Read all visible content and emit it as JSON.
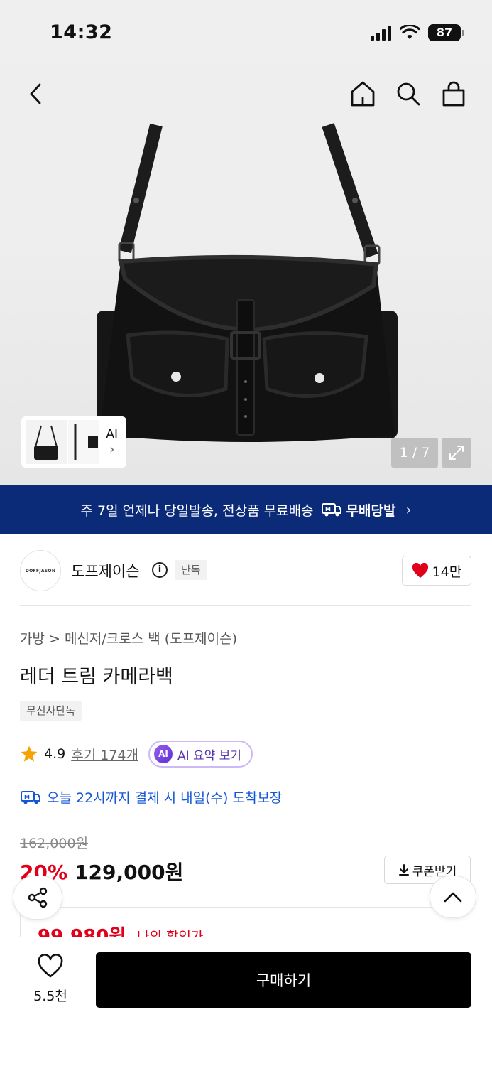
{
  "status_bar": {
    "time": "14:32",
    "battery": "87"
  },
  "gallery": {
    "thumb_label": "AI",
    "thumb_chevron": "›",
    "pager": "1 / 7",
    "icons": [
      "back-icon",
      "home-icon",
      "search-icon",
      "shopping-bag-icon",
      "expand-icon"
    ]
  },
  "shipping_banner": {
    "text": "주 7일 언제나 당일발송, 전상품 무료배송",
    "badge": "무배당발",
    "chevron": "›",
    "bg_color": "#0b2a78"
  },
  "brand": {
    "logo_text": "DOFFJASON",
    "name": "도프제이슨",
    "tag": "단독",
    "likes": "14만"
  },
  "product": {
    "breadcrumb": "가방 > 메신저/크로스 백 (도프제이슨)",
    "title": "레더 트림 카메라백",
    "exclusive_tag": "무신사단독",
    "rating": "4.9",
    "review_link": "후기 174개",
    "ai_chip_icon": "AI",
    "ai_chip_label": "AI 요약 보기",
    "delivery": "오늘 22시까지 결제 시 내일(수) 도착보장",
    "original_price": "162,000원",
    "discount": "20%",
    "price": "129,000원",
    "coupon_button": "쿠폰받기",
    "my_price": "99,980원",
    "my_price_label": "나의 할인가",
    "accent_color": "#e0001a"
  },
  "bottom_bar": {
    "wish_count": "5.5천",
    "buy_label": "구매하기"
  }
}
